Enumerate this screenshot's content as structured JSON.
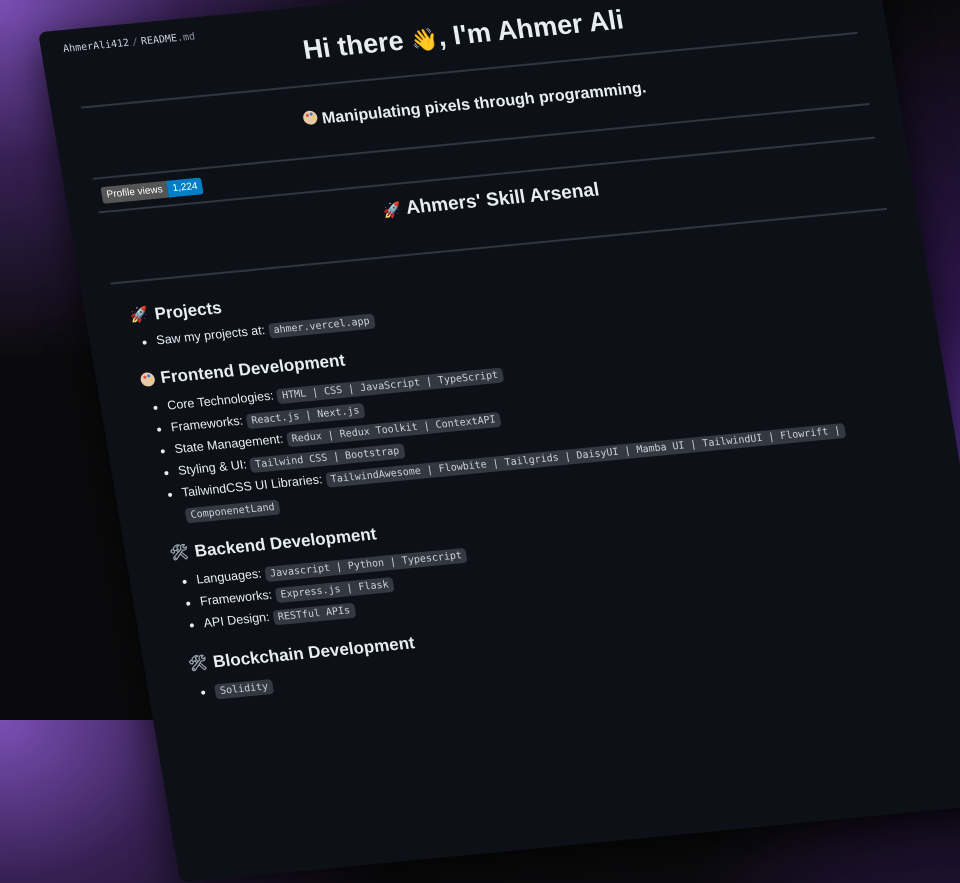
{
  "breadcrumb": {
    "user": "AhmerAli412",
    "separator": "/",
    "file": "README",
    "ext": ".md"
  },
  "header": {
    "greeting": "Hi there",
    "wave_emoji": "👋",
    "name": ", I'm Ahmer Ali",
    "tagline": "Manipulating pixels through programming."
  },
  "badge": {
    "label": "Profile views",
    "value": "1,224"
  },
  "arsenal_title": "Ahmers' Skill Arsenal",
  "sections": {
    "projects": {
      "title": "Projects",
      "items": [
        {
          "label": "Saw my projects at:",
          "code": "ahmer.vercel.app"
        }
      ]
    },
    "frontend": {
      "title": "Frontend Development",
      "items": [
        {
          "label": "Core Technologies:",
          "code": "HTML | CSS | JavaScript | TypeScript"
        },
        {
          "label": "Frameworks:",
          "code": "React.js | Next.js"
        },
        {
          "label": "State Management:",
          "code": "Redux | Redux Toolkit | ContextAPI"
        },
        {
          "label": "Styling & UI:",
          "code": "Tailwind CSS | Bootstrap"
        },
        {
          "label": "TailwindCSS UI Libraries:",
          "code": "TailwindAwesome | Flowbite | Tailgrids | DaisyUI | Mamba UI | TailwindUI | Flowrift |",
          "code2": "ComponenetLand"
        }
      ]
    },
    "backend": {
      "title": "Backend Development",
      "items": [
        {
          "label": "Languages:",
          "code": "Javascript | Python | Typescript"
        },
        {
          "label": "Frameworks:",
          "code": "Express.js | Flask"
        },
        {
          "label": "API Design:",
          "code": "RESTful APIs"
        }
      ]
    },
    "blockchain": {
      "title": "Blockchain Development",
      "items": [
        {
          "label": "",
          "code": "Solidity"
        }
      ]
    }
  }
}
